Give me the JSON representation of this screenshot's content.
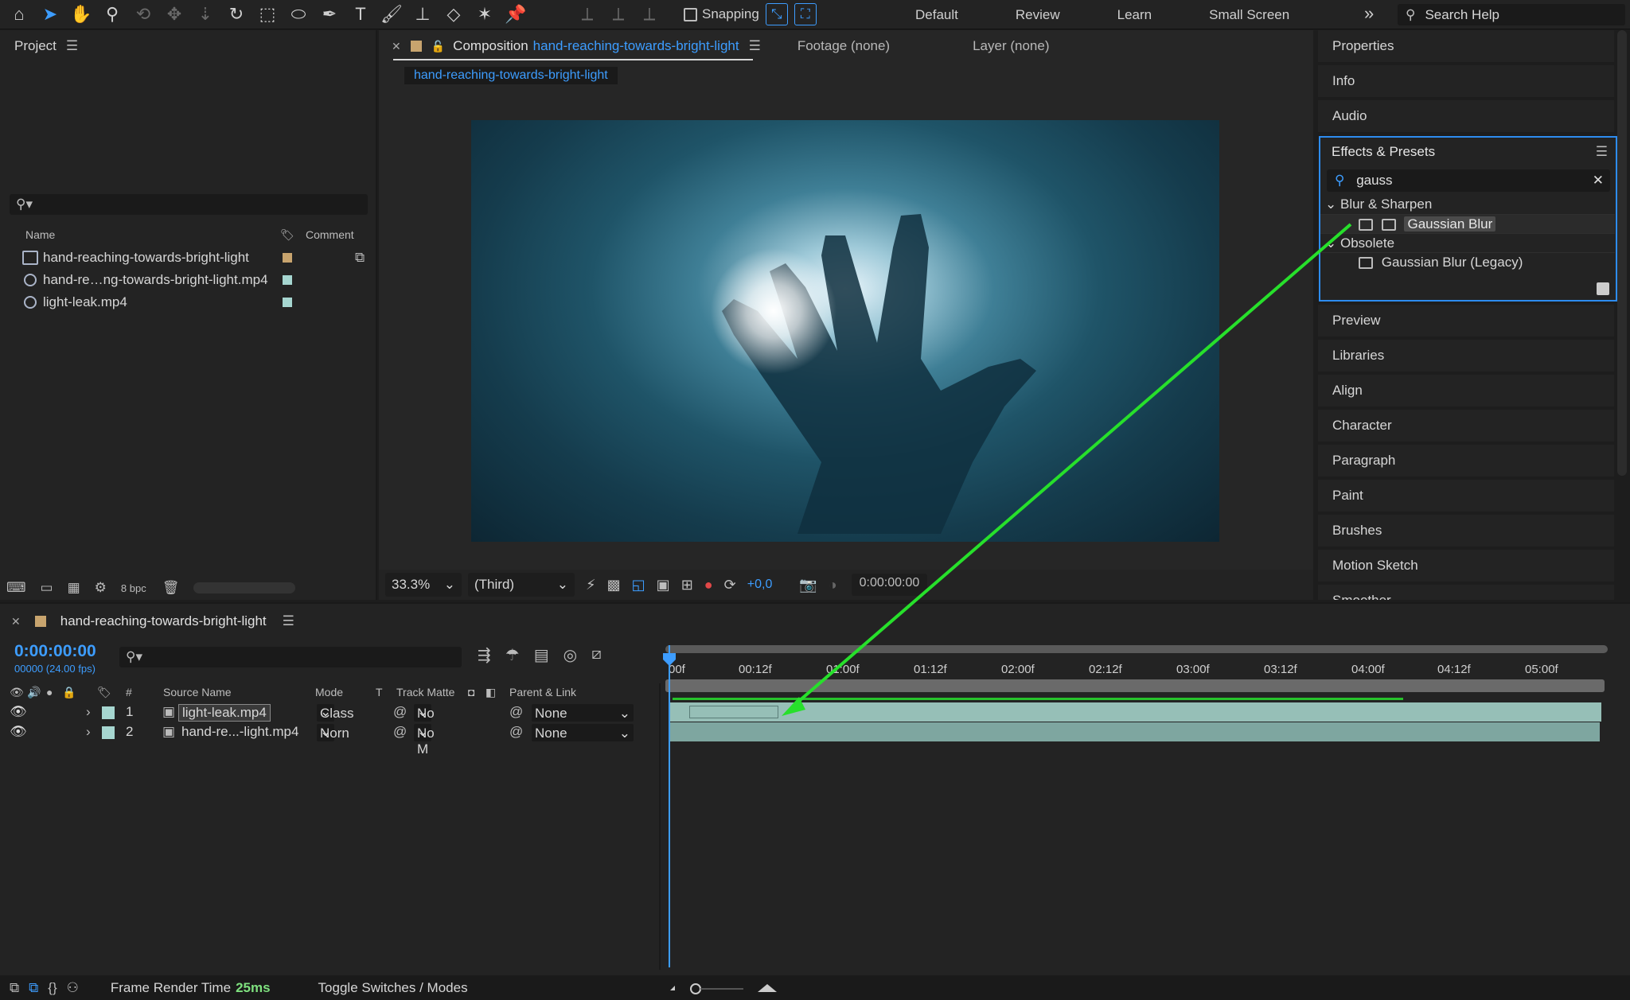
{
  "toolbar": {
    "snapping_label": "Snapping",
    "workspaces": [
      "Default",
      "Review",
      "Learn",
      "Small Screen"
    ],
    "search_help": "Search Help"
  },
  "project": {
    "title": "Project",
    "search_value": "",
    "columns": [
      "Name",
      "Comment"
    ],
    "items": [
      {
        "name": "hand-reaching-towards-bright-light",
        "label_color": "#c8a46e"
      },
      {
        "name": "hand-re…ng-towards-bright-light.mp4",
        "label_color": "#a6d6d0"
      },
      {
        "name": "light-leak.mp4",
        "label_color": "#a6d6d0"
      }
    ],
    "bpc": "8 bpc"
  },
  "comp": {
    "tab_prefix": "Composition",
    "tab_name": "hand-reaching-towards-bright-light",
    "footage_tab": "Footage (none)",
    "layer_tab": "Layer (none)",
    "subtab": "hand-reaching-towards-bright-light",
    "zoom": "33.3%",
    "resolution": "(Third)",
    "exposure": "+0,0",
    "timecode": "0:00:00:00"
  },
  "right": {
    "items_top": [
      "Properties",
      "Info",
      "Audio"
    ],
    "effects": {
      "title": "Effects & Presets",
      "search_value": "gauss",
      "group1": "Blur & Sharpen",
      "item1": "Gaussian Blur",
      "group2": "Obsolete",
      "item2": "Gaussian Blur (Legacy)"
    },
    "items_bottom": [
      "Preview",
      "Libraries",
      "Align",
      "Character",
      "Paragraph",
      "Paint",
      "Brushes",
      "Motion Sketch",
      "Smoother"
    ]
  },
  "timeline": {
    "tab": "hand-reaching-towards-bright-light",
    "timecode": "0:00:00:00",
    "fps": "00000 (24.00 fps)",
    "columns": {
      "num": "#",
      "source": "Source Name",
      "mode": "Mode",
      "t": "T",
      "track_matte": "Track Matte",
      "parent": "Parent & Link"
    },
    "layers": [
      {
        "num": "1",
        "name": "light-leak.mp4",
        "mode": "Class",
        "matte": "No M",
        "parent": "None"
      },
      {
        "num": "2",
        "name": "hand-re...-light.mp4",
        "mode": "Norn",
        "matte": "No M",
        "parent": "None"
      }
    ],
    "ruler": [
      "00f",
      "00:12f",
      "01:00f",
      "01:12f",
      "02:00f",
      "02:12f",
      "03:00f",
      "03:12f",
      "04:00f",
      "04:12f",
      "05:00f"
    ]
  },
  "status": {
    "frame_render_label": "Frame Render Time",
    "frame_render_value": "25ms",
    "toggle": "Toggle Switches / Modes"
  },
  "colors": {
    "accent": "#3d9dff",
    "annotation_arrow": "#27e02b"
  }
}
